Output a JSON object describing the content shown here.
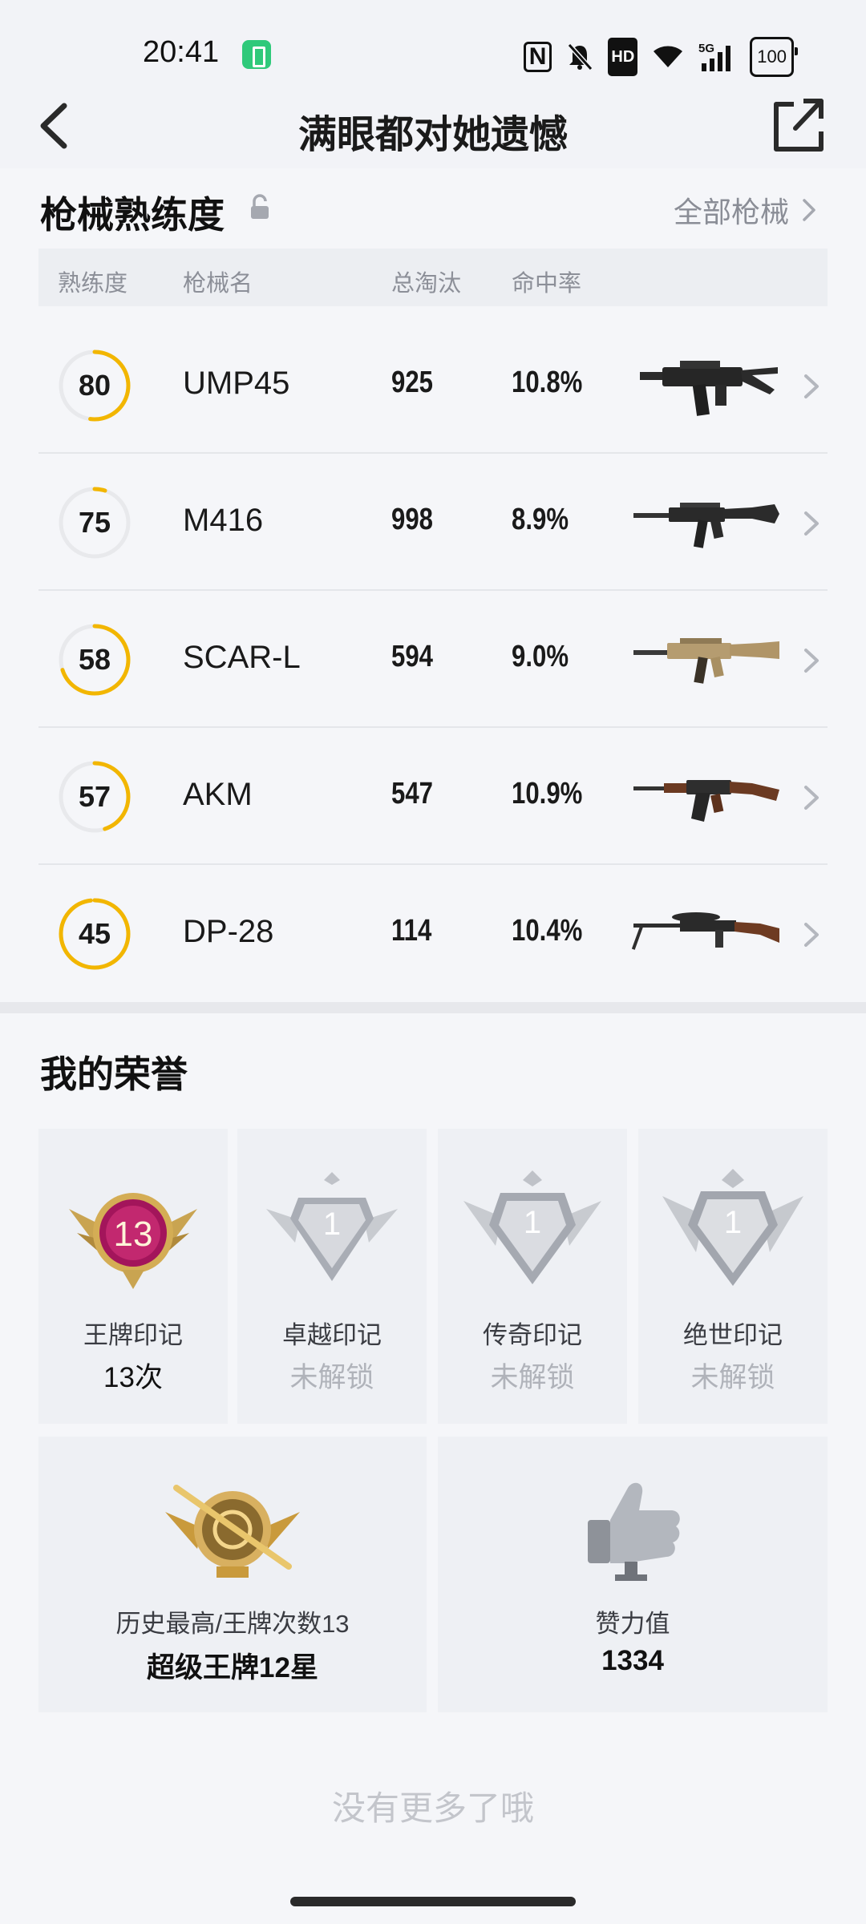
{
  "status_bar": {
    "time": "20:41",
    "nfc": "N",
    "hd": "HD",
    "network": "5G",
    "battery": "100",
    "icons": [
      "battery-saver-icon",
      "nfc-icon",
      "mute-icon",
      "hd-icon",
      "wifi-icon",
      "signal-icon",
      "battery-icon"
    ]
  },
  "header": {
    "title": "满眼都对她遗憾",
    "back_icon": "back-arrow-icon",
    "share_icon": "share-icon"
  },
  "weapons": {
    "heading": "枪械熟练度",
    "all_link": "全部枪械",
    "columns": [
      "熟练度",
      "枪械名",
      "总淘汰",
      "命中率"
    ],
    "accent_color": "#f2b600",
    "items": [
      {
        "proficiency": "80",
        "ring_progress": 0.52,
        "name": "UMP45",
        "eliminations": "925",
        "hit_rate": "10.8%"
      },
      {
        "proficiency": "75",
        "ring_progress": 0.05,
        "name": "M416",
        "eliminations": "998",
        "hit_rate": "8.9%"
      },
      {
        "proficiency": "58",
        "ring_progress": 0.7,
        "name": "SCAR-L",
        "eliminations": "594",
        "hit_rate": "9.0%"
      },
      {
        "proficiency": "57",
        "ring_progress": 0.45,
        "name": "AKM",
        "eliminations": "547",
        "hit_rate": "10.9%"
      },
      {
        "proficiency": "45",
        "ring_progress": 0.98,
        "name": "DP-28",
        "eliminations": "114",
        "hit_rate": "10.4%"
      }
    ]
  },
  "honors": {
    "heading": "我的荣誉",
    "cards": [
      {
        "badge_number": "13",
        "label": "王牌印记",
        "value": "13次",
        "locked": false
      },
      {
        "badge_number": "1",
        "label": "卓越印记",
        "value": "未解锁",
        "locked": true
      },
      {
        "badge_number": "1",
        "label": "传奇印记",
        "value": "未解锁",
        "locked": true
      },
      {
        "badge_number": "1",
        "label": "绝世印记",
        "value": "未解锁",
        "locked": true
      }
    ],
    "history": {
      "label": "历史最高/王牌次数13",
      "value": "超级王牌12星"
    },
    "likes": {
      "label": "赞力值",
      "value": "1334"
    }
  },
  "footer_note": "没有更多了哦"
}
